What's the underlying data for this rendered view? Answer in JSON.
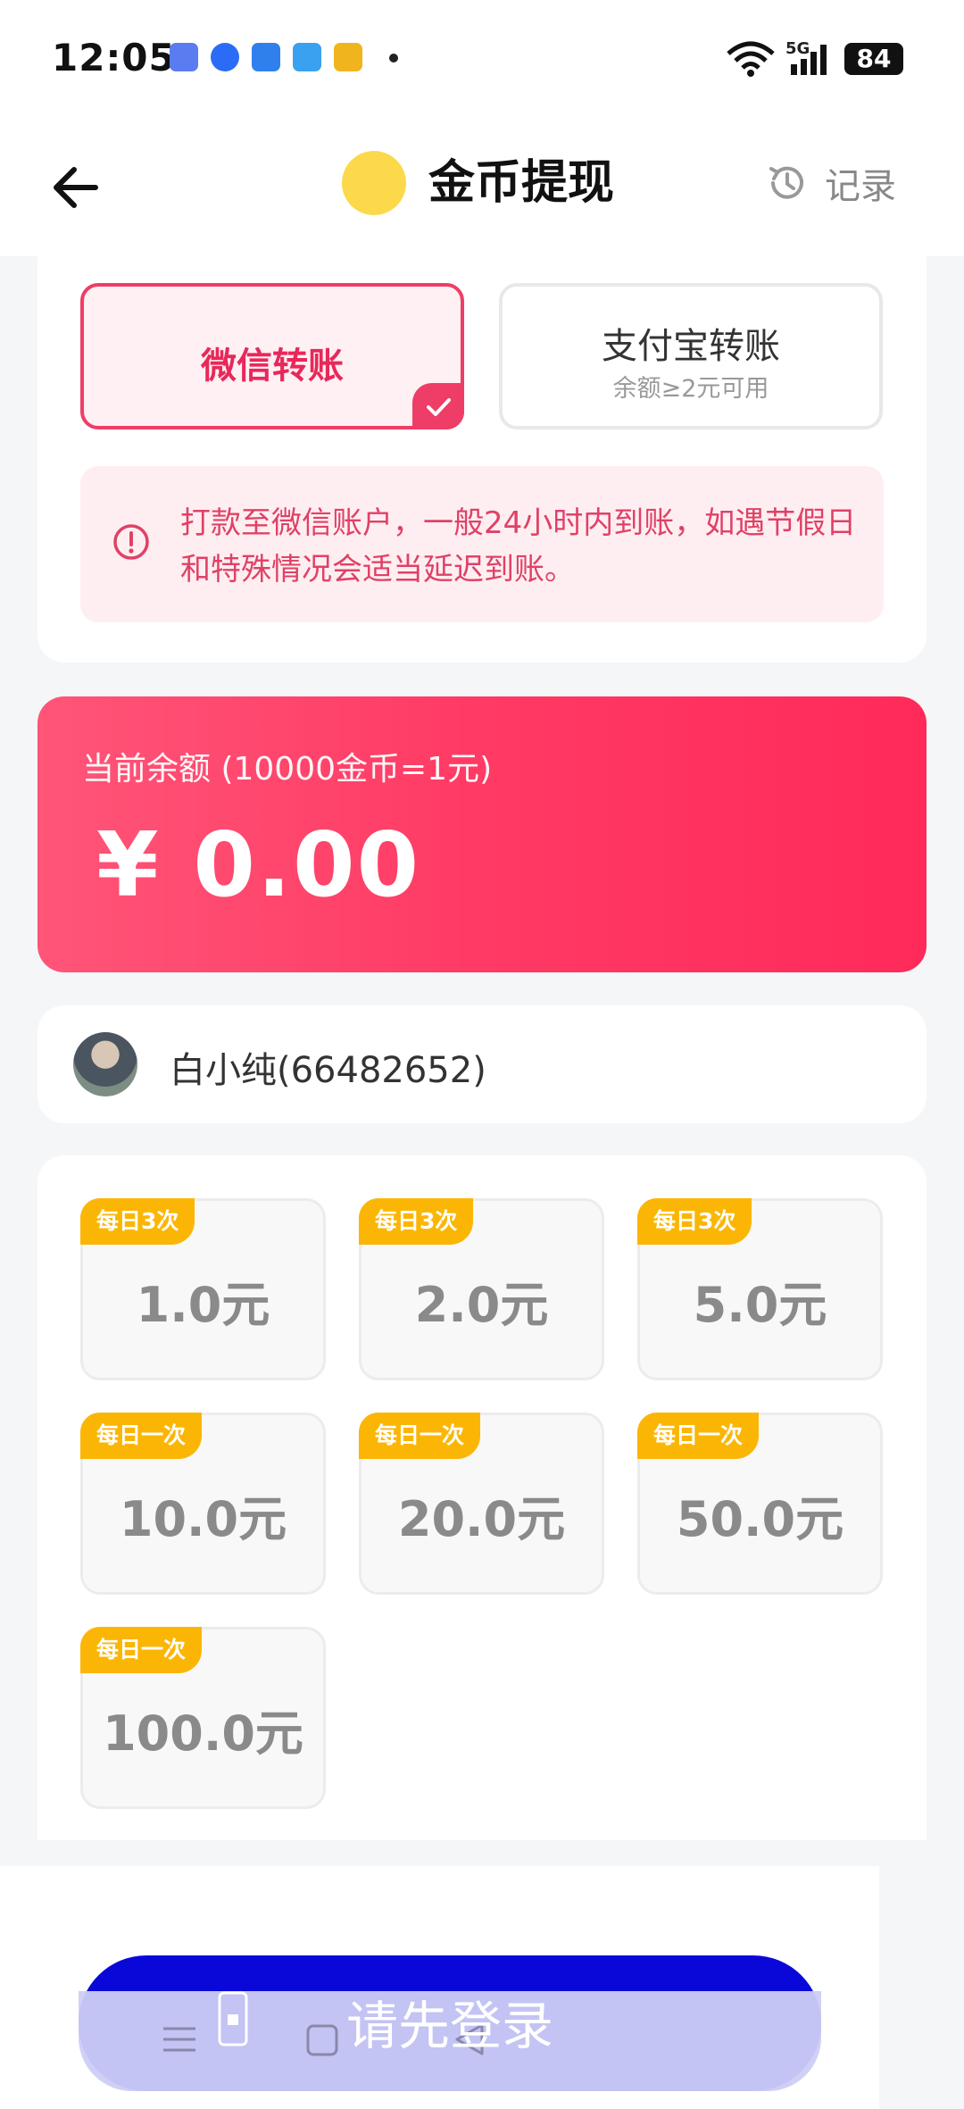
{
  "status_bar": {
    "time": "12:05",
    "battery": "84",
    "network": "5G"
  },
  "header": {
    "title": "金币提现",
    "records_label": "记录"
  },
  "payment_methods": {
    "wechat": {
      "label": "微信转账",
      "selected": true
    },
    "alipay": {
      "label": "支付宝转账",
      "sub": "余额≥2元可用"
    }
  },
  "notice": {
    "text": "打款至微信账户，一般24小时内到账，如遇节假日和特殊情况会适当延迟到账。"
  },
  "balance": {
    "label": "当前余额 (10000金币=1元)",
    "value": "¥ 0.00"
  },
  "user": {
    "name": "白小纯(66482652)"
  },
  "amounts": [
    {
      "tag": "每日3次",
      "value": "1.0元"
    },
    {
      "tag": "每日3次",
      "value": "2.0元"
    },
    {
      "tag": "每日3次",
      "value": "5.0元"
    },
    {
      "tag": "每日一次",
      "value": "10.0元"
    },
    {
      "tag": "每日一次",
      "value": "20.0元"
    },
    {
      "tag": "每日一次",
      "value": "50.0元"
    },
    {
      "tag": "每日一次",
      "value": "100.0元"
    }
  ],
  "login_button": {
    "label": "请先登录"
  },
  "colors": {
    "accent": "#ee3d66",
    "tag": "#fbb605",
    "button": "#0a08d8",
    "coin": "#fcd94b"
  }
}
